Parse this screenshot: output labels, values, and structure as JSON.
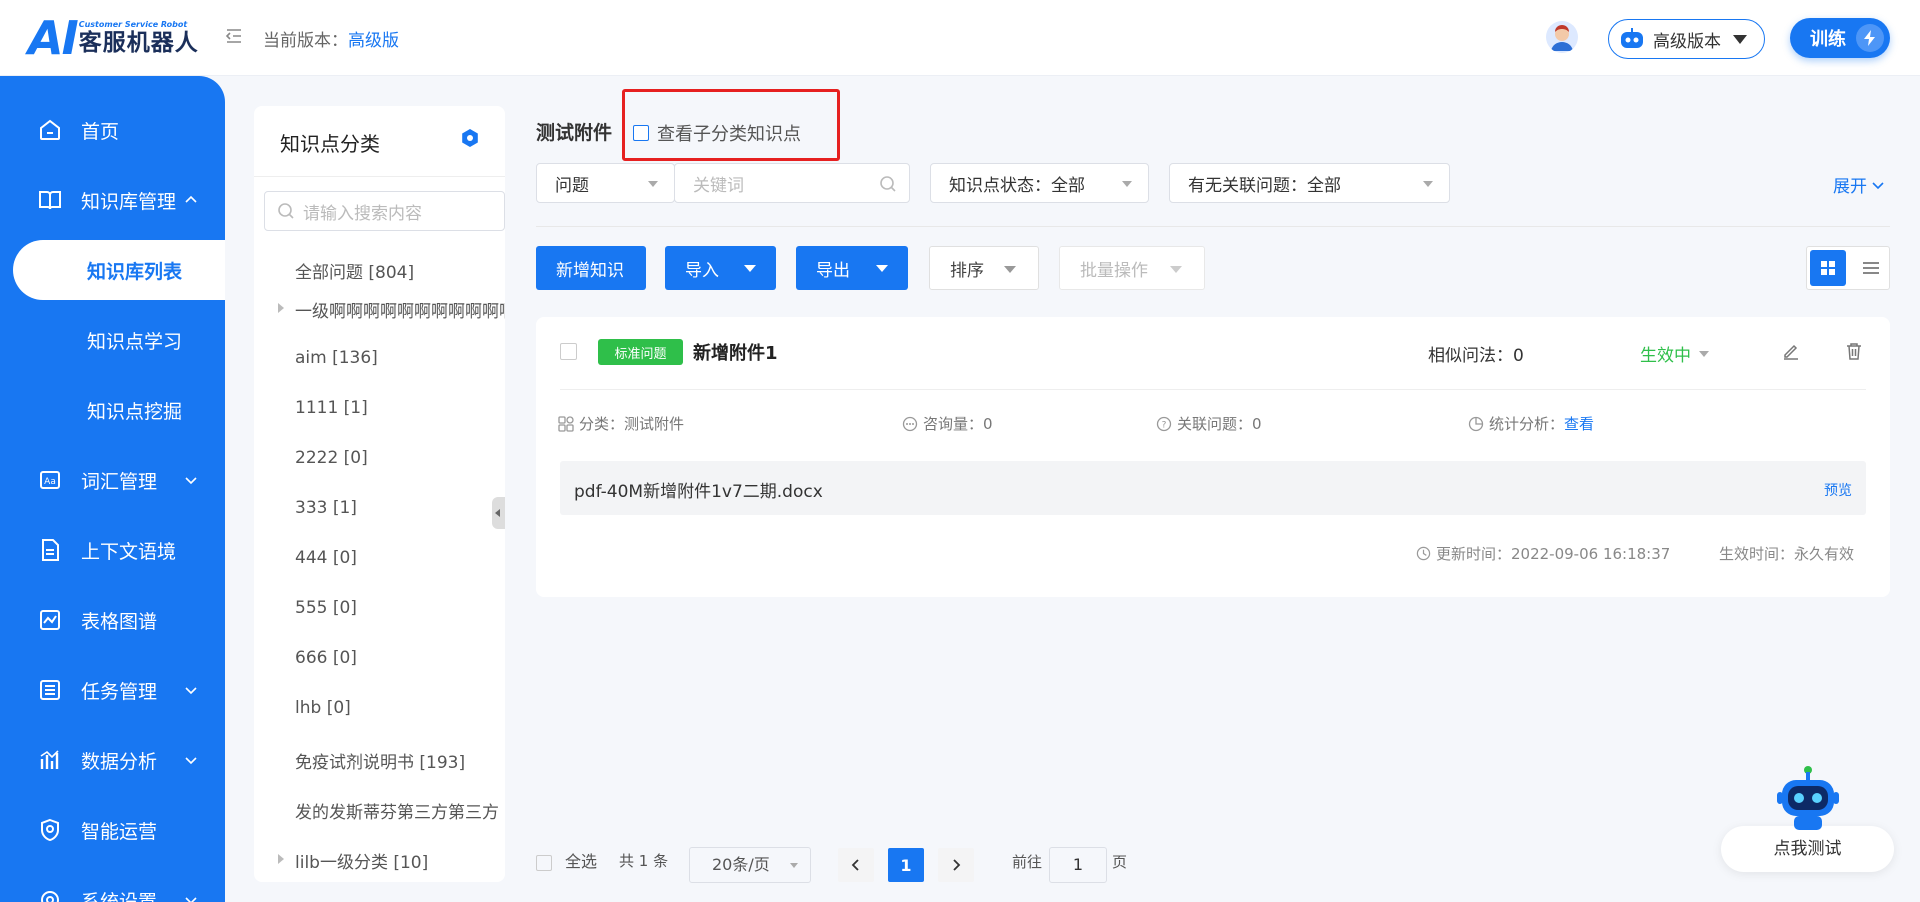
{
  "header": {
    "logo_ai": "AI",
    "logo_sub": "Customer Service Robot",
    "logo_name": "客服机器人",
    "version_prefix": "当前版本：",
    "version_value": "高级版",
    "version_select": "高级版本",
    "train_label": "训练"
  },
  "sidebar": {
    "items": [
      {
        "label": "首页",
        "icon": "home-icon"
      },
      {
        "label": "知识库管理",
        "icon": "book-icon"
      },
      {
        "label": "知识库列表"
      },
      {
        "label": "知识点学习"
      },
      {
        "label": "知识点挖掘"
      },
      {
        "label": "词汇管理",
        "icon": "vocab-icon"
      },
      {
        "label": "上下文语境",
        "icon": "document-icon"
      },
      {
        "label": "表格图谱",
        "icon": "chart-icon"
      },
      {
        "label": "任务管理",
        "icon": "task-icon"
      },
      {
        "label": "数据分析",
        "icon": "analytics-icon"
      },
      {
        "label": "智能运营",
        "icon": "shield-icon"
      },
      {
        "label": "系统设置",
        "icon": "settings-icon"
      }
    ]
  },
  "category": {
    "title": "知识点分类",
    "search_placeholder": "请输入搜索内容",
    "items": [
      "全部问题 [804]",
      "一级啊啊啊啊啊啊啊啊啊啊啊",
      "aim [136]",
      "1111 [1]",
      "2222 [0]",
      "333 [1]",
      "444 [0]",
      "555 [0]",
      "666 [0]",
      "lhb [0]",
      "免疫试剂说明书 [193]",
      "发的发斯蒂芬第三方第三方",
      "lilb一级分类 [10]"
    ]
  },
  "main": {
    "breadcrumb": "测试附件",
    "sub_check_label": "查看子分类知识点",
    "filters": {
      "type": "问题",
      "keyword_placeholder": "关键词",
      "status": "知识点状态：全部",
      "related": "有无关联问题：全部",
      "expand": "展开"
    },
    "buttons": {
      "add": "新增知识",
      "import": "导入",
      "export": "导出",
      "sort": "排序",
      "batch": "批量操作"
    },
    "card": {
      "tag": "标准问题",
      "title": "新增附件1",
      "similar": "相似问法：0",
      "status": "生效中",
      "category": "分类：测试附件",
      "consult": "咨询量：0",
      "related": "关联问题：0",
      "stats_label": "统计分析：",
      "stats_link": "查看",
      "attachment": "pdf-40M新增附件1v7二期.docx",
      "preview": "预览",
      "updated": "更新时间：2022-09-06 16:18:37",
      "effective": "生效时间：永久有效"
    },
    "pagination": {
      "select_all": "全选",
      "total": "共 1 条",
      "page_size": "20条/页",
      "current": "1",
      "goto_prefix": "前往",
      "goto_value": "1",
      "goto_suffix": "页"
    }
  },
  "widget": {
    "test_label": "点我测试"
  },
  "colors": {
    "primary": "#1877f2",
    "success": "#2fbf4a",
    "highlight": "#e62020"
  }
}
